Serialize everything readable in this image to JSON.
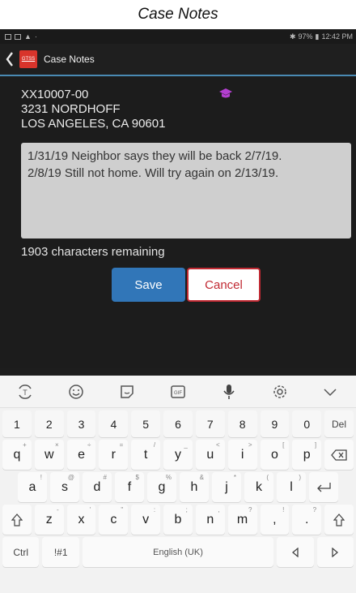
{
  "caption": "Case Notes",
  "status_bar": {
    "battery": "97%",
    "time": "12:42 PM"
  },
  "app_bar": {
    "logo_text": "GTSS",
    "title": "Case Notes"
  },
  "case": {
    "id": "XX10007-00",
    "street": "3231 NORDHOFF",
    "city": "LOS ANGELES, CA 90601"
  },
  "notes": {
    "text": "1/31/19 Neighbor says they will be back 2/7/19.\n2/8/19 Still not home. Will try again on 2/13/19."
  },
  "remaining": "1903 characters remaining",
  "buttons": {
    "save": "Save",
    "cancel": "Cancel"
  },
  "colors": {
    "save": "#3176b8",
    "cancel_border": "#c12a33",
    "appbar_underline": "#4a8ab3",
    "logo": "#d8342b"
  },
  "keyboard": {
    "number_row": [
      "1",
      "2",
      "3",
      "4",
      "5",
      "6",
      "7",
      "8",
      "9",
      "0",
      "Del"
    ],
    "row1": [
      {
        "k": "q",
        "a": "+"
      },
      {
        "k": "w",
        "a": "×"
      },
      {
        "k": "e",
        "a": "÷"
      },
      {
        "k": "r",
        "a": "="
      },
      {
        "k": "t",
        "a": "/"
      },
      {
        "k": "y",
        "a": "_"
      },
      {
        "k": "u",
        "a": "<"
      },
      {
        "k": "i",
        "a": ">"
      },
      {
        "k": "o",
        "a": "["
      },
      {
        "k": "p",
        "a": "]"
      }
    ],
    "row2": [
      {
        "k": "a",
        "a": "!"
      },
      {
        "k": "s",
        "a": "@"
      },
      {
        "k": "d",
        "a": "#"
      },
      {
        "k": "f",
        "a": "$"
      },
      {
        "k": "g",
        "a": "%"
      },
      {
        "k": "h",
        "a": "&"
      },
      {
        "k": "j",
        "a": "*"
      },
      {
        "k": "k",
        "a": "("
      },
      {
        "k": "l",
        "a": ")"
      }
    ],
    "row3": [
      {
        "k": "z",
        "a": "-"
      },
      {
        "k": "x",
        "a": "'"
      },
      {
        "k": "c",
        "a": "\""
      },
      {
        "k": "v",
        "a": ":"
      },
      {
        "k": "b",
        "a": ";"
      },
      {
        "k": "n",
        "a": ","
      },
      {
        "k": "m",
        "a": "?"
      },
      {
        "k": ",",
        "a": "!"
      },
      {
        "k": ".",
        "a": "?"
      }
    ],
    "ctrl": "Ctrl",
    "symbols": "!#1",
    "space": "English (UK)",
    "icons": [
      "translate-icon",
      "emoji-icon",
      "sticker-icon",
      "gif-icon",
      "mic-icon",
      "settings-icon",
      "collapse-icon"
    ]
  }
}
